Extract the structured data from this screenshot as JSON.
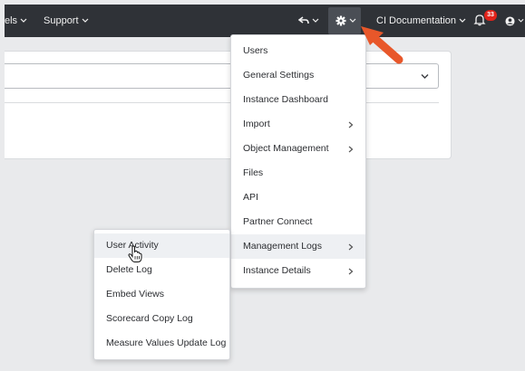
{
  "topbar": {
    "partial_item": "els",
    "support_label": "Support",
    "ci_documentation_label": "CI Documentation",
    "notifications_count": "33",
    "icons": {
      "undo": "undo-icon",
      "settings": "gear-icon",
      "bell": "bell-icon",
      "user": "user-icon"
    }
  },
  "settings_menu": {
    "items": [
      {
        "label": "Users",
        "has_submenu": false
      },
      {
        "label": "General Settings",
        "has_submenu": false
      },
      {
        "label": "Instance Dashboard",
        "has_submenu": false
      },
      {
        "label": "Import",
        "has_submenu": true
      },
      {
        "label": "Object Management",
        "has_submenu": true
      },
      {
        "label": "Files",
        "has_submenu": false
      },
      {
        "label": "API",
        "has_submenu": false
      },
      {
        "label": "Partner Connect",
        "has_submenu": false
      },
      {
        "label": "Management Logs",
        "has_submenu": true
      },
      {
        "label": "Instance Details",
        "has_submenu": true
      }
    ]
  },
  "management_logs_submenu": {
    "items": [
      {
        "label": "User Activity"
      },
      {
        "label": "Delete Log"
      },
      {
        "label": "Embed Views"
      },
      {
        "label": "Scorecard Copy Log"
      },
      {
        "label": "Measure Values Update Log"
      }
    ]
  },
  "colors": {
    "topbar": "#2f3237",
    "badge": "#e2231a",
    "annotation_arrow": "#e8572a",
    "hover_row": "#eef0f3"
  }
}
